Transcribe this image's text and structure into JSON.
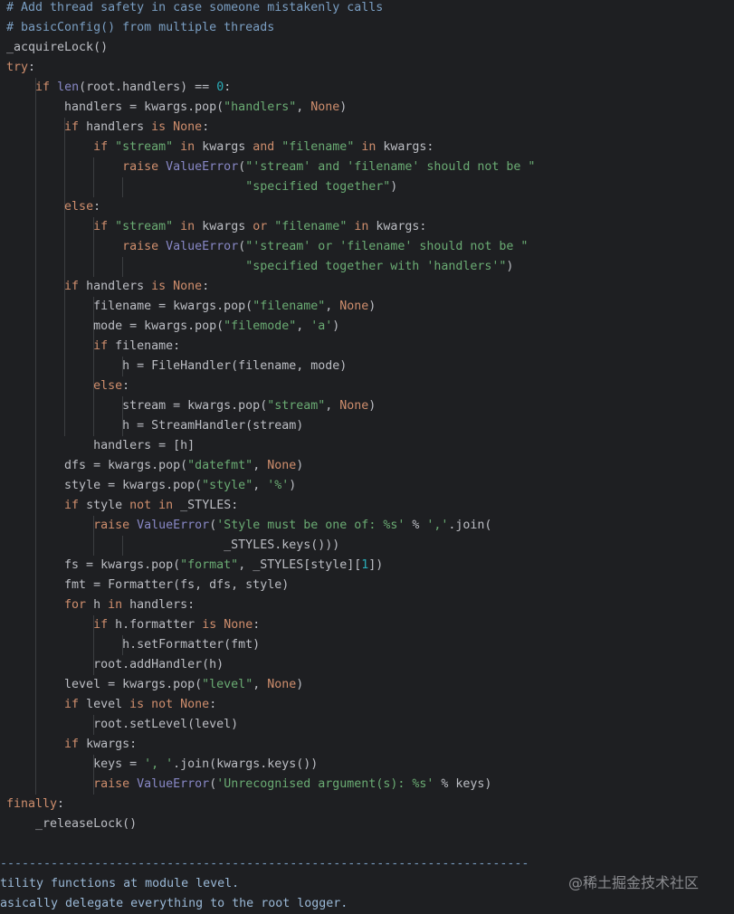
{
  "editor": {
    "language": "python",
    "colors": {
      "background": "#1e1f22",
      "text": "#bcbec4",
      "keyword": "#cf8e6d",
      "string": "#6aab73",
      "number": "#2aacb8",
      "comment": "#7a9ec2",
      "builtin": "#8888c6"
    },
    "lines": [
      [
        [
          "cmt",
          "# Add thread safety in case someone mistakenly calls"
        ]
      ],
      [
        [
          "cmt",
          "# basicConfig() from multiple threads"
        ]
      ],
      [
        [
          "plain",
          "_acquireLock()"
        ]
      ],
      [
        [
          "kw",
          "try"
        ],
        [
          "plain",
          ":"
        ]
      ],
      [
        [
          "plain",
          "    "
        ],
        [
          "kw",
          "if "
        ],
        [
          "bi",
          "len"
        ],
        [
          "plain",
          "(root.handlers) == "
        ],
        [
          "num",
          "0"
        ],
        [
          "plain",
          ":"
        ]
      ],
      [
        [
          "plain",
          "        handlers = kwargs.pop("
        ],
        [
          "str",
          "\"handlers\""
        ],
        [
          "plain",
          ", "
        ],
        [
          "kw",
          "None"
        ],
        [
          "plain",
          ")"
        ]
      ],
      [
        [
          "plain",
          "        "
        ],
        [
          "kw",
          "if "
        ],
        [
          "plain",
          "handlers "
        ],
        [
          "kw",
          "is None"
        ],
        [
          "plain",
          ":"
        ]
      ],
      [
        [
          "plain",
          "            "
        ],
        [
          "kw",
          "if "
        ],
        [
          "str",
          "\"stream\""
        ],
        [
          "kw",
          " in "
        ],
        [
          "plain",
          "kwargs "
        ],
        [
          "kw",
          "and "
        ],
        [
          "str",
          "\"filename\""
        ],
        [
          "kw",
          " in "
        ],
        [
          "plain",
          "kwargs:"
        ]
      ],
      [
        [
          "plain",
          "                "
        ],
        [
          "kw",
          "raise "
        ],
        [
          "bi",
          "ValueError"
        ],
        [
          "plain",
          "("
        ],
        [
          "str",
          "\"'stream' and 'filename' should not be \""
        ]
      ],
      [
        [
          "plain",
          "                                 "
        ],
        [
          "str",
          "\"specified together\""
        ],
        [
          "plain",
          ")"
        ]
      ],
      [
        [
          "plain",
          "        "
        ],
        [
          "kw",
          "else"
        ],
        [
          "plain",
          ":"
        ]
      ],
      [
        [
          "plain",
          "            "
        ],
        [
          "kw",
          "if "
        ],
        [
          "str",
          "\"stream\""
        ],
        [
          "kw",
          " in "
        ],
        [
          "plain",
          "kwargs "
        ],
        [
          "kw",
          "or "
        ],
        [
          "str",
          "\"filename\""
        ],
        [
          "kw",
          " in "
        ],
        [
          "plain",
          "kwargs:"
        ]
      ],
      [
        [
          "plain",
          "                "
        ],
        [
          "kw",
          "raise "
        ],
        [
          "bi",
          "ValueError"
        ],
        [
          "plain",
          "("
        ],
        [
          "str",
          "\"'stream' or 'filename' should not be \""
        ]
      ],
      [
        [
          "plain",
          "                                 "
        ],
        [
          "str",
          "\"specified together with 'handlers'\""
        ],
        [
          "plain",
          ")"
        ]
      ],
      [
        [
          "plain",
          "        "
        ],
        [
          "kw",
          "if "
        ],
        [
          "plain",
          "handlers "
        ],
        [
          "kw",
          "is None"
        ],
        [
          "plain",
          ":"
        ]
      ],
      [
        [
          "plain",
          "            filename = kwargs.pop("
        ],
        [
          "str",
          "\"filename\""
        ],
        [
          "plain",
          ", "
        ],
        [
          "kw",
          "None"
        ],
        [
          "plain",
          ")"
        ]
      ],
      [
        [
          "plain",
          "            mode = kwargs.pop("
        ],
        [
          "str",
          "\"filemode\""
        ],
        [
          "plain",
          ", "
        ],
        [
          "str",
          "'a'"
        ],
        [
          "plain",
          ")"
        ]
      ],
      [
        [
          "plain",
          "            "
        ],
        [
          "kw",
          "if "
        ],
        [
          "plain",
          "filename:"
        ]
      ],
      [
        [
          "plain",
          "                h = FileHandler(filename, mode)"
        ]
      ],
      [
        [
          "plain",
          "            "
        ],
        [
          "kw",
          "else"
        ],
        [
          "plain",
          ":"
        ]
      ],
      [
        [
          "plain",
          "                stream = kwargs.pop("
        ],
        [
          "str",
          "\"stream\""
        ],
        [
          "plain",
          ", "
        ],
        [
          "kw",
          "None"
        ],
        [
          "plain",
          ")"
        ]
      ],
      [
        [
          "plain",
          "                h = StreamHandler(stream)"
        ]
      ],
      [
        [
          "plain",
          "            handlers = [h]"
        ]
      ],
      [
        [
          "plain",
          "        dfs = kwargs.pop("
        ],
        [
          "str",
          "\"datefmt\""
        ],
        [
          "plain",
          ", "
        ],
        [
          "kw",
          "None"
        ],
        [
          "plain",
          ")"
        ]
      ],
      [
        [
          "plain",
          "        style = kwargs.pop("
        ],
        [
          "str",
          "\"style\""
        ],
        [
          "plain",
          ", "
        ],
        [
          "str",
          "'%'"
        ],
        [
          "plain",
          ")"
        ]
      ],
      [
        [
          "plain",
          "        "
        ],
        [
          "kw",
          "if "
        ],
        [
          "plain",
          "style "
        ],
        [
          "kw",
          "not in "
        ],
        [
          "plain",
          "_STYLES:"
        ]
      ],
      [
        [
          "plain",
          "            "
        ],
        [
          "kw",
          "raise "
        ],
        [
          "bi",
          "ValueError"
        ],
        [
          "plain",
          "("
        ],
        [
          "str",
          "'Style must be one of: %s'"
        ],
        [
          "plain",
          " % "
        ],
        [
          "str",
          "','"
        ],
        [
          "plain",
          ".join("
        ]
      ],
      [
        [
          "plain",
          "                              _STYLES.keys()))"
        ]
      ],
      [
        [
          "plain",
          "        fs = kwargs.pop("
        ],
        [
          "str",
          "\"format\""
        ],
        [
          "plain",
          ", _STYLES[style]["
        ],
        [
          "num",
          "1"
        ],
        [
          "plain",
          "])"
        ]
      ],
      [
        [
          "plain",
          "        fmt = Formatter(fs, dfs, style)"
        ]
      ],
      [
        [
          "plain",
          "        "
        ],
        [
          "kw",
          "for "
        ],
        [
          "plain",
          "h "
        ],
        [
          "kw",
          "in "
        ],
        [
          "plain",
          "handlers:"
        ]
      ],
      [
        [
          "plain",
          "            "
        ],
        [
          "kw",
          "if "
        ],
        [
          "plain",
          "h.formatter "
        ],
        [
          "kw",
          "is None"
        ],
        [
          "plain",
          ":"
        ]
      ],
      [
        [
          "plain",
          "                h.setFormatter(fmt)"
        ]
      ],
      [
        [
          "plain",
          "            root.addHandler(h)"
        ]
      ],
      [
        [
          "plain",
          "        level = kwargs.pop("
        ],
        [
          "str",
          "\"level\""
        ],
        [
          "plain",
          ", "
        ],
        [
          "kw",
          "None"
        ],
        [
          "plain",
          ")"
        ]
      ],
      [
        [
          "plain",
          "        "
        ],
        [
          "kw",
          "if "
        ],
        [
          "plain",
          "level "
        ],
        [
          "kw",
          "is not None"
        ],
        [
          "plain",
          ":"
        ]
      ],
      [
        [
          "plain",
          "            root.setLevel(level)"
        ]
      ],
      [
        [
          "plain",
          "        "
        ],
        [
          "kw",
          "if "
        ],
        [
          "plain",
          "kwargs:"
        ]
      ],
      [
        [
          "plain",
          "            keys = "
        ],
        [
          "str",
          "', '"
        ],
        [
          "plain",
          ".join(kwargs.keys())"
        ]
      ],
      [
        [
          "plain",
          "            "
        ],
        [
          "kw",
          "raise "
        ],
        [
          "bi",
          "ValueError"
        ],
        [
          "plain",
          "("
        ],
        [
          "str",
          "'Unrecognised argument(s): %s'"
        ],
        [
          "plain",
          " % keys)"
        ]
      ],
      [
        [
          "kw",
          "finally"
        ],
        [
          "plain",
          ":"
        ]
      ],
      [
        [
          "plain",
          "    _releaseLock()"
        ]
      ],
      [
        [
          "plain",
          ""
        ]
      ],
      [
        [
          "sep",
          "-------------------------------------------------------------------------"
        ]
      ],
      [
        [
          "dim",
          "tility functions at module level."
        ]
      ],
      [
        [
          "dim",
          "asically delegate everything to the root logger."
        ]
      ]
    ]
  },
  "watermark": "@稀土掘金技术社区"
}
